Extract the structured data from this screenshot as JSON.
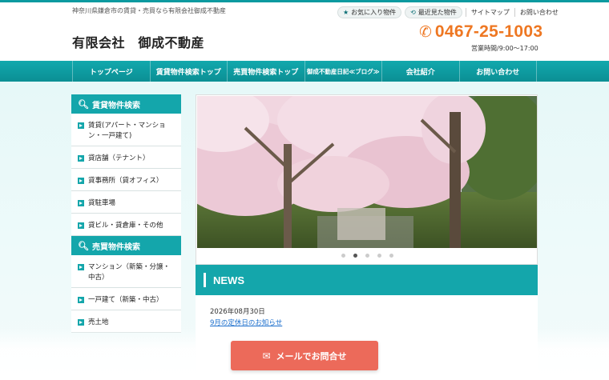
{
  "header": {
    "tagline": "神奈川県鎌倉市の賃貸・売買なら有限会社御成不動産",
    "favorites": "お気に入り物件",
    "recent": "最近見た物件",
    "sitemap": "サイトマップ",
    "contact": "お問い合わせ",
    "company": "有限会社　御成不動産",
    "phone": "0467-25-1003",
    "hours": "営業時間/9:00～17:00"
  },
  "nav": {
    "items": [
      {
        "label": "トップページ"
      },
      {
        "label": "賃貸物件検索トップ"
      },
      {
        "label": "売買物件検索トップ"
      },
      {
        "label": "御成不動産日記≪ブログ≫"
      },
      {
        "label": "会社紹介"
      },
      {
        "label": "お問い合わせ"
      }
    ]
  },
  "sidebar": {
    "rent_title": "賃貸物件検索",
    "rent_items": [
      {
        "label": "賃貸(アパート・マンション・一戸建て)"
      },
      {
        "label": "貸店舗（テナント）"
      },
      {
        "label": "貸事務所（貸オフィス）"
      },
      {
        "label": "貸駐車場"
      },
      {
        "label": "貸ビル・貸倉庫・その他"
      }
    ],
    "sale_title": "売買物件検索",
    "sale_items": [
      {
        "label": "マンション（新築・分譲・中古）"
      },
      {
        "label": "一戸建て（新築・中古）"
      },
      {
        "label": "売土地"
      }
    ]
  },
  "slider": {
    "dots": 5,
    "active_dot": 1
  },
  "news": {
    "title": "NEWS",
    "items": [
      {
        "date": "2026年08月30日",
        "title": "9月の定休日のお知らせ"
      }
    ]
  },
  "mail_button": {
    "label": "メールでお問合せ"
  },
  "colors": {
    "accent": "#14a6ab",
    "phone": "#ee7722",
    "mail_button": "#ec6a5a"
  }
}
